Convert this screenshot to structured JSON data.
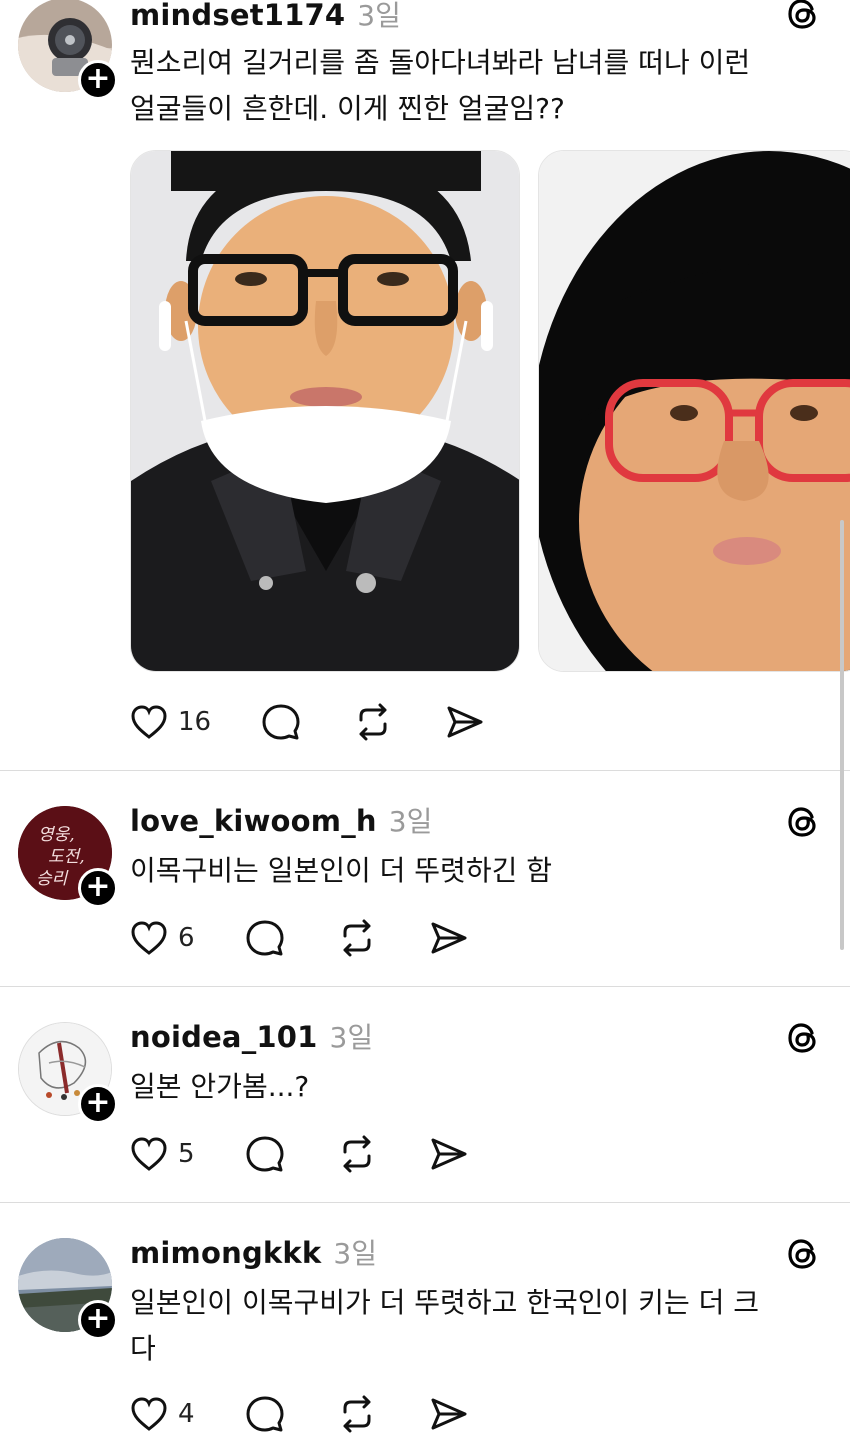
{
  "posts": [
    {
      "username": "mindset1174",
      "time": "3일",
      "lines": [
        "뭔소리여 길거리를 좀 돌아다녀봐라 남녀를 떠나 이런",
        "얼굴들이 흔한데. 이게 찐한 얼굴임??"
      ],
      "likes": "16",
      "avatar": "watch-photo",
      "follow": "+"
    },
    {
      "username": "love_kiwoom_h",
      "time": "3일",
      "lines": [
        "이목구비는 일본인이 더 뚜렷하긴 함"
      ],
      "likes": "6",
      "avatar": "calligraphy",
      "avatar_text": [
        "영웅,",
        "도전,",
        "승리"
      ],
      "follow": "+"
    },
    {
      "username": "noidea_101",
      "time": "3일",
      "lines": [
        "일본 안가봄...?"
      ],
      "likes": "5",
      "avatar": "sketch",
      "follow": "+"
    },
    {
      "username": "mimongkkk",
      "time": "3일",
      "lines": [
        "일본인이 이목구비가 더 뚜렷하고 한국인이 키는 더 크",
        "다"
      ],
      "likes": "4",
      "avatar": "sky-photo",
      "follow": "+"
    }
  ],
  "icons": {
    "like": "heart-icon",
    "reply": "comment-icon",
    "repost": "repost-icon",
    "share": "send-icon",
    "brand": "threads-icon"
  },
  "colors": {
    "text": "#111111",
    "muted": "#9a9a9a",
    "divider": "#dcdcdc",
    "glasses_red": "#e0393f"
  }
}
